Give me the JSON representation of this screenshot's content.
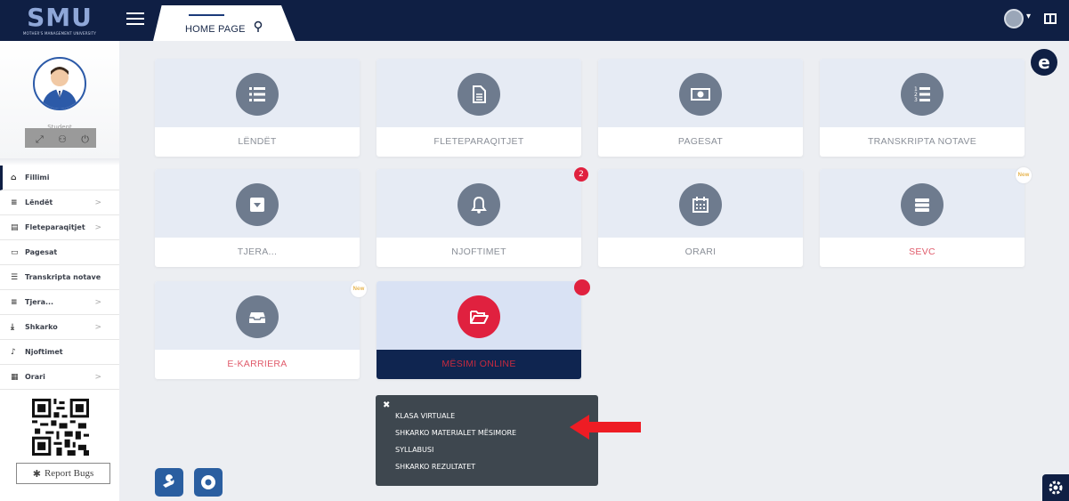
{
  "header": {
    "logo_text": "SMU",
    "logo_subtitle": "MOTHER'S MANAGEMENT UNIVERSITY",
    "home_tab_label": "HOME PAGE",
    "brand_color": "#0f1f44",
    "accent_color": "#e0213f"
  },
  "profile": {
    "role": "Student",
    "icons": [
      "expand-icon",
      "sitemap-icon",
      "power-icon"
    ]
  },
  "sidebar": {
    "items": [
      {
        "label": "Fillimi",
        "icon": "home-icon",
        "active": true,
        "chevron": ""
      },
      {
        "label": "Lëndët",
        "icon": "list-icon",
        "active": false,
        "chevron": ">"
      },
      {
        "label": "Fleteparaqitjet",
        "icon": "document-icon",
        "active": false,
        "chevron": ">"
      },
      {
        "label": "Pagesat",
        "icon": "card-icon",
        "active": false,
        "chevron": ""
      },
      {
        "label": "Transkripta notave",
        "icon": "numbered-list-icon",
        "active": false,
        "chevron": ""
      },
      {
        "label": "Tjera...",
        "icon": "menu-icon",
        "active": false,
        "chevron": ">"
      },
      {
        "label": "Shkarko",
        "icon": "download-icon",
        "active": false,
        "chevron": ">"
      },
      {
        "label": "Njoftimet",
        "icon": "bell-icon",
        "active": false,
        "chevron": ""
      },
      {
        "label": "Orari",
        "icon": "calendar-icon",
        "active": false,
        "chevron": ">"
      }
    ],
    "report_bugs": "Report Bugs"
  },
  "tiles": [
    {
      "label": "LËNDËT",
      "icon": "list-icon"
    },
    {
      "label": "FLETEPARAQITJET",
      "icon": "document-icon"
    },
    {
      "label": "PAGESAT",
      "icon": "money-icon"
    },
    {
      "label": "TRANSKRIPTA NOTAVE",
      "icon": "numbered-list-icon"
    },
    {
      "label": "TJERA...",
      "icon": "caret-square-icon"
    },
    {
      "label": "NJOFTIMET",
      "icon": "bell-icon",
      "badge": "2"
    },
    {
      "label": "ORARI",
      "icon": "calendar-icon"
    },
    {
      "label": "SEVC",
      "icon": "server-icon",
      "badge": "New"
    },
    {
      "label": "E-KARRIERA",
      "icon": "inbox-icon",
      "badge": "New"
    },
    {
      "label": "MËSIMI ONLINE",
      "icon": "folder-open-icon"
    }
  ],
  "popup": {
    "items": [
      "KLASA VIRTUALE",
      "SHKARKO MATERIALET MËSIMORE",
      "SYLLABUSI",
      "SHKARKO REZULTATET"
    ]
  }
}
